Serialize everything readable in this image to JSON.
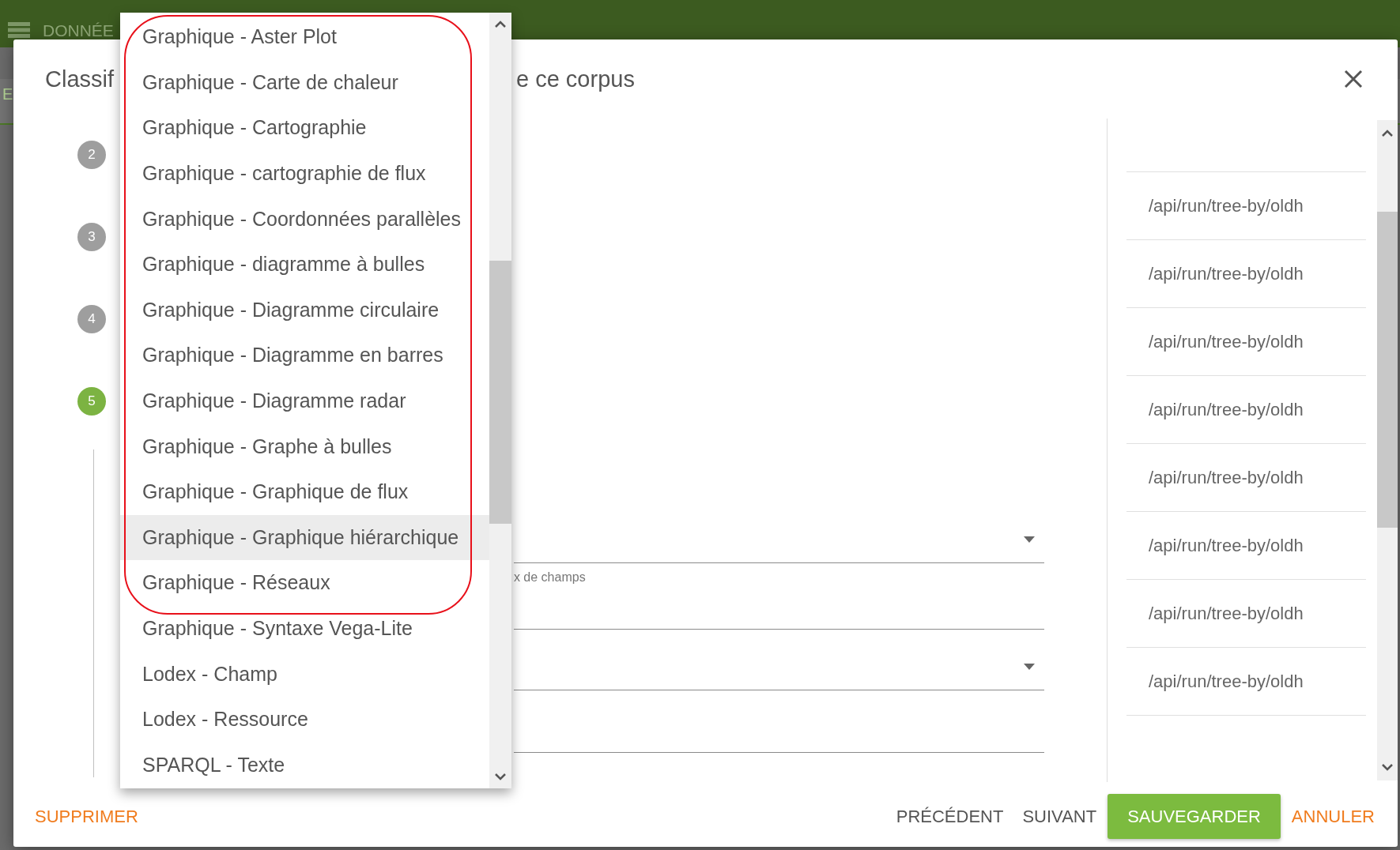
{
  "app_bar": {
    "title": "DONNÉE"
  },
  "backdrop": {
    "tab": "E"
  },
  "dialog": {
    "title_parts": [
      "Classif",
      "e ce corpus"
    ],
    "steps": [
      {
        "number": "2",
        "active": false
      },
      {
        "number": "3",
        "active": false
      },
      {
        "number": "4",
        "active": false
      },
      {
        "number": "5",
        "active": true
      }
    ],
    "fields": [
      {
        "kind": "select",
        "helper": "x de champs"
      },
      {
        "kind": "text"
      },
      {
        "kind": "select"
      },
      {
        "kind": "text"
      }
    ],
    "routes": [
      "/api/run/tree-by/oldh",
      "/api/run/tree-by/oldh",
      "/api/run/tree-by/oldh",
      "/api/run/tree-by/oldh",
      "/api/run/tree-by/oldh",
      "/api/run/tree-by/oldh",
      "/api/run/tree-by/oldh",
      "/api/run/tree-by/oldh"
    ],
    "footer": {
      "delete": "SUPPRIMER",
      "previous": "PRÉCÉDENT",
      "next": "SUIVANT",
      "save": "SAUVEGARDER",
      "cancel": "ANNULER"
    }
  },
  "dropdown": {
    "items": [
      {
        "label": "Graphique - Aster Plot",
        "selected": false,
        "circled": true
      },
      {
        "label": "Graphique - Carte de chaleur",
        "selected": false,
        "circled": true
      },
      {
        "label": "Graphique - Cartographie",
        "selected": false,
        "circled": true
      },
      {
        "label": "Graphique - cartographie de flux",
        "selected": false,
        "circled": true
      },
      {
        "label": "Graphique - Coordonnées parallèles",
        "selected": false,
        "circled": true
      },
      {
        "label": "Graphique - diagramme à bulles",
        "selected": false,
        "circled": true
      },
      {
        "label": "Graphique - Diagramme circulaire",
        "selected": false,
        "circled": true
      },
      {
        "label": "Graphique - Diagramme en barres",
        "selected": false,
        "circled": true
      },
      {
        "label": "Graphique - Diagramme radar",
        "selected": false,
        "circled": true
      },
      {
        "label": "Graphique - Graphe à bulles",
        "selected": false,
        "circled": true
      },
      {
        "label": "Graphique - Graphique de flux",
        "selected": false,
        "circled": true
      },
      {
        "label": "Graphique - Graphique hiérarchique",
        "selected": true,
        "circled": true
      },
      {
        "label": "Graphique - Réseaux",
        "selected": false,
        "circled": true
      },
      {
        "label": "Graphique - Syntaxe Vega-Lite",
        "selected": false,
        "circled": false
      },
      {
        "label": "Lodex - Champ",
        "selected": false,
        "circled": false
      },
      {
        "label": "Lodex - Ressource",
        "selected": false,
        "circled": false
      },
      {
        "label": "SPARQL - Texte",
        "selected": false,
        "circled": false
      }
    ]
  }
}
